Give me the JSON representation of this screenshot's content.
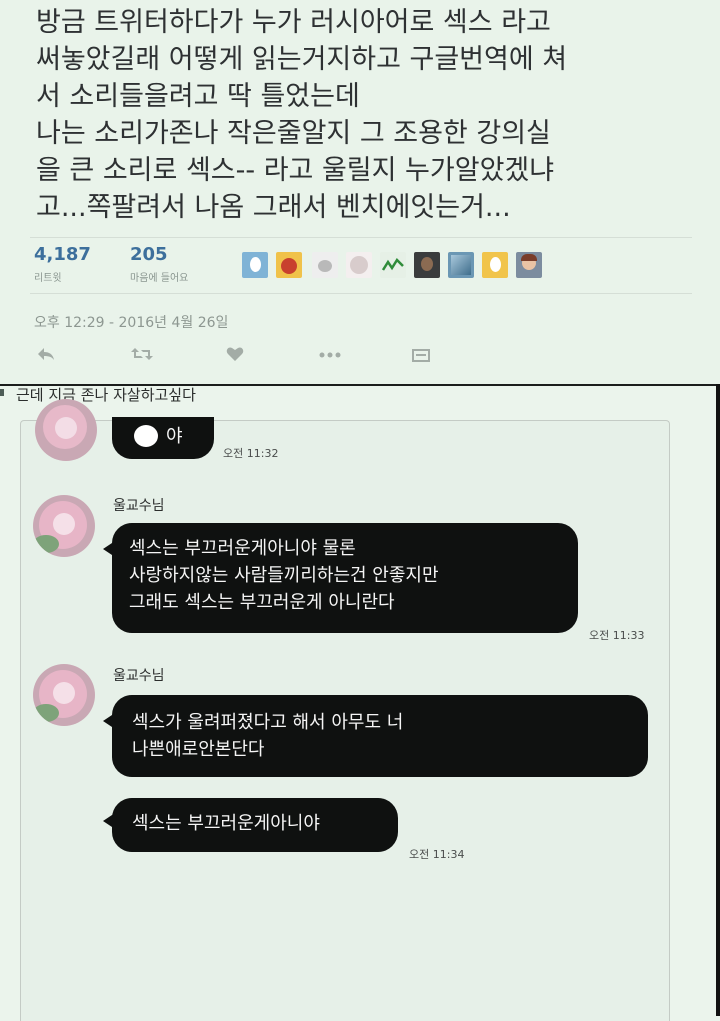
{
  "tweet": {
    "lines": [
      "방금 트위터하다가 누가 러시아어로 섹스 라고",
      "써놓았길래 어떻게 읽는거지하고 구글번역에 쳐",
      "서 소리들을려고 딱 틀었는데",
      "나는 소리가존나 작은줄알지 그 조용한 강의실",
      "을 큰 소리로 섹스-- 라고 울릴지 누가알았겠냐",
      "고...쪽팔려서 나옴 그래서 벤치에잇는거..."
    ],
    "retweets": {
      "count": "4,187",
      "label": "리트윗"
    },
    "likes": {
      "count": "205",
      "label": "마음에 들어요"
    },
    "timestamp": "오후 12:29 - 2016년 4월 26일",
    "actions": [
      "reply-icon",
      "retweet-icon",
      "like-icon",
      "more-icon",
      "stats-icon"
    ],
    "colors": {
      "count": "#3d6f9c",
      "muted": "#8d9791",
      "text": "#2e3133"
    }
  },
  "chat": {
    "caption": "근데 지금 존나 자살하고싶다",
    "partial_bubble_text": "야",
    "partial_time": "오전 11:32",
    "messages": [
      {
        "sender": "울교수님",
        "lines": [
          "섹스는 부끄러운게아니야 물론",
          "사랑하지않는 사람들끼리하는건 안좋지만",
          "그래도 섹스는 부끄러운게 아니란다"
        ],
        "time": "오전 11:33"
      },
      {
        "sender": "울교수님",
        "lines": [
          "섹스가 울려퍼졌다고 해서 아무도 너",
          "나쁜애로안본단다"
        ],
        "time": ""
      },
      {
        "sender": "",
        "lines": [
          "섹스는 부끄러운게아니야"
        ],
        "time": "오전 11:34"
      }
    ],
    "colors": {
      "bubble": "#0f1110",
      "bubble_text": "#f5f5f5",
      "background": "#e6f0e8"
    }
  }
}
